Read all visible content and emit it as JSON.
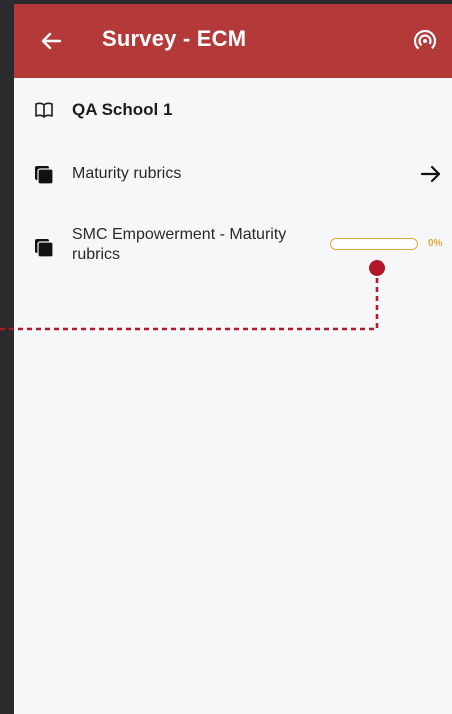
{
  "appbar": {
    "title": "Survey - ECM",
    "background": "#b43a3a",
    "back_icon": "arrow-left-icon",
    "action_icon": "signal-icon"
  },
  "school": {
    "icon": "book-open-icon",
    "name": "QA School 1"
  },
  "items": [
    {
      "icon": "stack-icon",
      "label": "Maturity rubrics",
      "trailing": "arrow-right-icon"
    },
    {
      "icon": "stack-icon",
      "label": "SMC Empowerment - Maturity rubrics",
      "progress": 0,
      "progress_label": "0%"
    }
  ],
  "colors": {
    "accent": "#b43a3a",
    "progress": "#e3a63a",
    "annotation": "#b2182b"
  }
}
